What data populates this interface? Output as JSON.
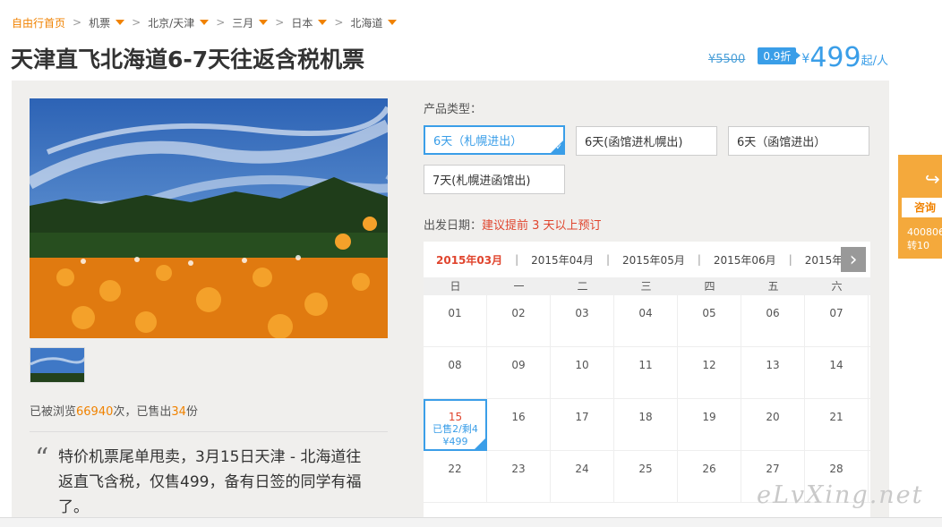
{
  "breadcrumb": {
    "home": "自由行首页",
    "items": [
      "机票",
      "北京/天津",
      "三月",
      "日本",
      "北海道"
    ]
  },
  "title": "天津直飞北海道6-7天往返含税机票",
  "price": {
    "original": "¥5500",
    "discount": "0.9折",
    "currency": "¥",
    "amount": "499",
    "unit": "起/人"
  },
  "gallery": {
    "stats_prefix": "已被浏览",
    "views": "66940",
    "stats_mid": "次，已售出",
    "sold": "34",
    "stats_suffix": "份"
  },
  "description": "特价机票尾单甩卖，3月15日天津 - 北海道往返直飞含税，仅售499，备有日签的同学有福了。",
  "product_types": {
    "label": "产品类型：",
    "options": [
      "6天（札幌进出）",
      "6天(函馆进札幌出)",
      "6天（函馆进出）",
      "7天(札幌进函馆出)"
    ]
  },
  "departure": {
    "label": "出发日期：",
    "hint": "建议提前 3 天以上预订"
  },
  "calendar": {
    "months": [
      "2015年03月",
      "2015年04月",
      "2015年05月",
      "2015年06月",
      "2015年"
    ],
    "weekdays": [
      "日",
      "一",
      "二",
      "三",
      "四",
      "五",
      "六"
    ],
    "rows": [
      [
        "01",
        "02",
        "03",
        "04",
        "05",
        "06",
        "07"
      ],
      [
        "08",
        "09",
        "10",
        "11",
        "12",
        "13",
        "14"
      ],
      [
        "15",
        "16",
        "17",
        "18",
        "19",
        "20",
        "21"
      ],
      [
        "22",
        "23",
        "24",
        "25",
        "26",
        "27",
        "28"
      ]
    ],
    "selected": {
      "day": "15",
      "sold_info": "已售2/剩4",
      "price": "¥499"
    }
  },
  "side_widget": {
    "label": "咨询",
    "phone1": "400806",
    "phone2": "转10"
  },
  "watermark": "eLvXing.net",
  "colors": {
    "accent": "#f08200",
    "blue": "#3a9ee8",
    "red": "#e0452e"
  }
}
